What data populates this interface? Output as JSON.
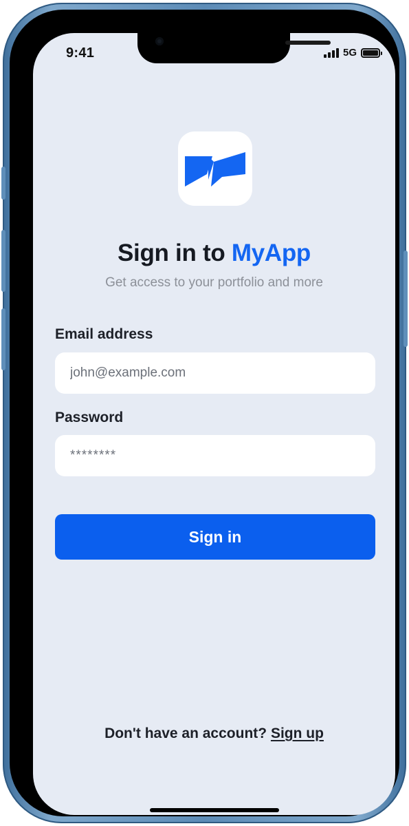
{
  "status_bar": {
    "time": "9:41",
    "network": "5G",
    "signal_icon": "signal-bars-icon",
    "battery_icon": "battery-full-icon",
    "battery_level": 1.0
  },
  "logo": {
    "icon": "myapp-logo-icon",
    "color": "#1466f2"
  },
  "header": {
    "title_prefix": "Sign in to",
    "brand_name": "MyApp",
    "subtitle": "Get access to your portfolio and more"
  },
  "form": {
    "email_label": "Email address",
    "email_placeholder": "john@example.com",
    "password_label": "Password",
    "password_placeholder": "********",
    "submit_label": "Sign in"
  },
  "footer": {
    "prompt": "Don't have an account?",
    "link": "Sign up"
  },
  "colors": {
    "accent": "#0b5fee",
    "background": "#e6ebf4",
    "frame": "#5c8bb6"
  }
}
